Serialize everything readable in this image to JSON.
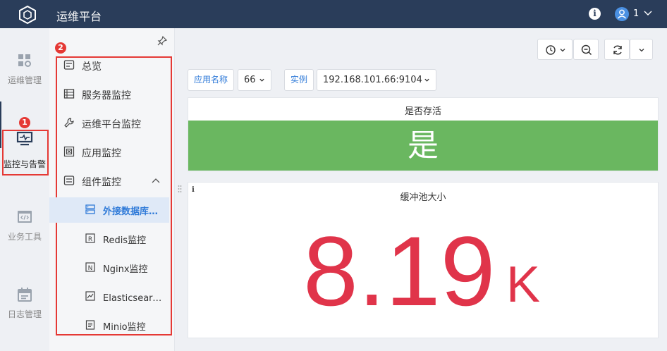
{
  "app": {
    "title": "运维平台"
  },
  "header": {
    "user_name": "1"
  },
  "rail": {
    "items": [
      {
        "label": "运维管理",
        "icon": "grid-icon"
      },
      {
        "label": "监控与告警",
        "icon": "monitor-icon"
      },
      {
        "label": "业务工具",
        "icon": "code-window-icon"
      },
      {
        "label": "日志管理",
        "icon": "calendar-icon"
      }
    ]
  },
  "annotations": {
    "badge1": "1",
    "badge2": "2"
  },
  "menu": {
    "items": [
      {
        "label": "总览",
        "icon": "overview-icon"
      },
      {
        "label": "服务器监控",
        "icon": "server-icon"
      },
      {
        "label": "运维平台监控",
        "icon": "wrench-icon"
      },
      {
        "label": "应用监控",
        "icon": "app-icon"
      },
      {
        "label": "组件监控",
        "icon": "component-icon"
      }
    ],
    "sub_items": [
      {
        "label": "外接数据库监控",
        "icon": "database-icon",
        "selected": true
      },
      {
        "label": "Redis监控",
        "icon": "redis-icon"
      },
      {
        "label": "Nginx监控",
        "icon": "nginx-icon"
      },
      {
        "label": "Elasticsearch监控",
        "icon": "chart-icon"
      },
      {
        "label": "Minio监控",
        "icon": "document-icon"
      }
    ]
  },
  "filters": {
    "app_label": "应用名称",
    "app_value": "66",
    "instance_label": "实例",
    "instance_value": "192.168.101.66:9104"
  },
  "panels": {
    "alive": {
      "title": "是否存活",
      "value": "是",
      "color": "#6ab760"
    },
    "buffer": {
      "title": "缓冲池大小",
      "value": "8.19",
      "unit": "K",
      "color": "#e0344a"
    }
  },
  "colors": {
    "topbar": "#2a3d5a",
    "accent": "#2f7ad8",
    "annotation": "#e53935"
  }
}
